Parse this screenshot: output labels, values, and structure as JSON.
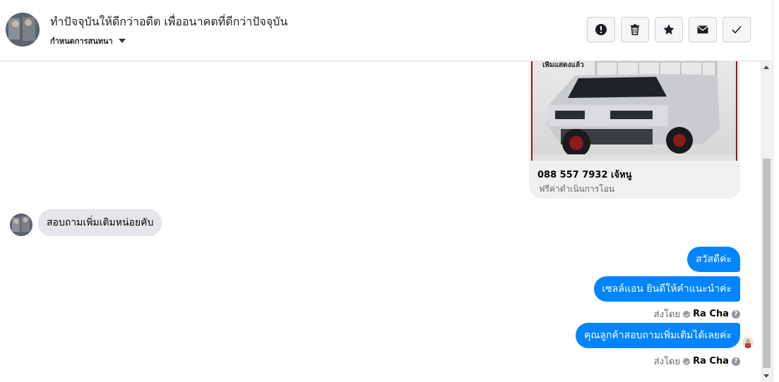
{
  "header": {
    "title": "ทำปัจจุบันให้ดีกว่าอดีต เพื่ออนาคตที่ดีกว่าปัจจุบัน",
    "subtitle": "กำหนดการสนทนา",
    "actions": [
      {
        "name": "report",
        "icon": "exclamation-circle-icon"
      },
      {
        "name": "delete",
        "icon": "trash-icon"
      },
      {
        "name": "star",
        "icon": "star-icon"
      },
      {
        "name": "mark-unread",
        "icon": "envelope-icon"
      },
      {
        "name": "mark-done",
        "icon": "checkmark-icon"
      }
    ]
  },
  "card": {
    "image_caption": "เพิ่มแสดงแล้ว",
    "title": "088 557 7932 เจ้หนู",
    "subtitle": "ฟรีค่าดำเนินการโอน"
  },
  "messages": {
    "incoming": "สอบถามเพิ่มเติมหน่อยคับ",
    "outgoing": [
      "สวัสดีค่ะ",
      "เซลล์แอน ยินดีให้คำแนะนำค่ะ",
      "คุณลูกค้าสอบถามเพิ่มเติมได้เลยค่ะ"
    ],
    "sent_by_label": "ส่งโดย",
    "sender_name": "Ra Cha"
  },
  "colors": {
    "outgoing_bubble": "#0084ff",
    "incoming_bubble": "#e4e6eb"
  }
}
